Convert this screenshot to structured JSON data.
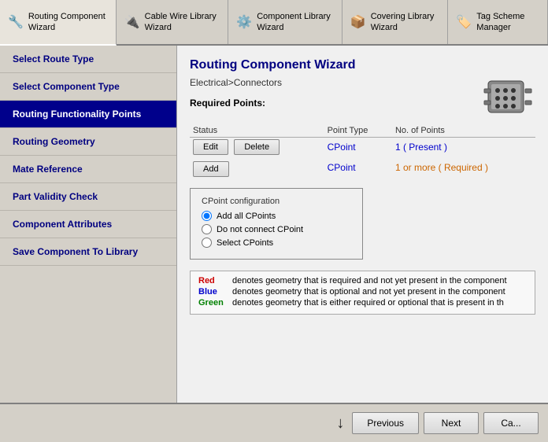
{
  "toolbar": {
    "items": [
      {
        "id": "routing-wizard",
        "label": "Routing Component Wizard",
        "icon": "🔧"
      },
      {
        "id": "cable-wizard",
        "label": "Cable Wire Library Wizard",
        "icon": "🔌"
      },
      {
        "id": "component-wizard",
        "label": "Component Library Wizard",
        "icon": "⚙️"
      },
      {
        "id": "covering-wizard",
        "label": "Covering Library Wizard",
        "icon": "📦"
      },
      {
        "id": "tag-manager",
        "label": "Tag Scheme Manager",
        "icon": "🏷️"
      }
    ]
  },
  "sidebar": {
    "items": [
      {
        "id": "select-route-type",
        "label": "Select Route Type",
        "active": false
      },
      {
        "id": "select-component-type",
        "label": "Select Component Type",
        "active": false
      },
      {
        "id": "routing-functionality-points",
        "label": "Routing Functionality Points",
        "active": true
      },
      {
        "id": "routing-geometry",
        "label": "Routing Geometry",
        "active": false
      },
      {
        "id": "mate-reference",
        "label": "Mate Reference",
        "active": false
      },
      {
        "id": "part-validity-check",
        "label": "Part Validity Check",
        "active": false
      },
      {
        "id": "component-attributes",
        "label": "Component Attributes",
        "active": false
      },
      {
        "id": "save-to-library",
        "label": "Save Component To Library",
        "active": false
      }
    ]
  },
  "content": {
    "title": "Routing Component Wizard",
    "breadcrumb": "Electrical>Connectors",
    "required_points_label": "Required Points:",
    "table": {
      "columns": [
        "Status",
        "Point Type",
        "No. of Points"
      ],
      "rows": [
        {
          "status": "",
          "point_type": "CPoint",
          "points": "1 ( Present )",
          "points_color": "blue",
          "has_edit": true,
          "has_delete": true
        },
        {
          "status": "",
          "point_type": "CPoint",
          "points": "1 or more ( Required )",
          "points_color": "orange",
          "has_add": true
        }
      ]
    },
    "buttons": {
      "edit": "Edit",
      "delete": "Delete",
      "add": "Add"
    },
    "cpoint_config": {
      "title": "CPoint configuration",
      "options": [
        {
          "id": "add-all",
          "label": "Add all CPoints",
          "selected": true
        },
        {
          "id": "no-connect",
          "label": "Do not connect CPoint",
          "selected": false
        },
        {
          "id": "select",
          "label": "Select CPoints",
          "selected": false
        }
      ]
    },
    "legend": {
      "entries": [
        {
          "color": "Red",
          "color_hex": "#cc0000",
          "text": "denotes geometry that is required and not yet present in the component"
        },
        {
          "color": "Blue",
          "color_hex": "#0000cc",
          "text": "denotes geometry that is optional and not yet present in the component"
        },
        {
          "color": "Green",
          "color_hex": "#008000",
          "text": "denotes geometry that is either required or optional that is present in th"
        }
      ]
    }
  },
  "footer": {
    "previous_label": "Previous",
    "next_label": "Next",
    "cancel_label": "Ca..."
  }
}
